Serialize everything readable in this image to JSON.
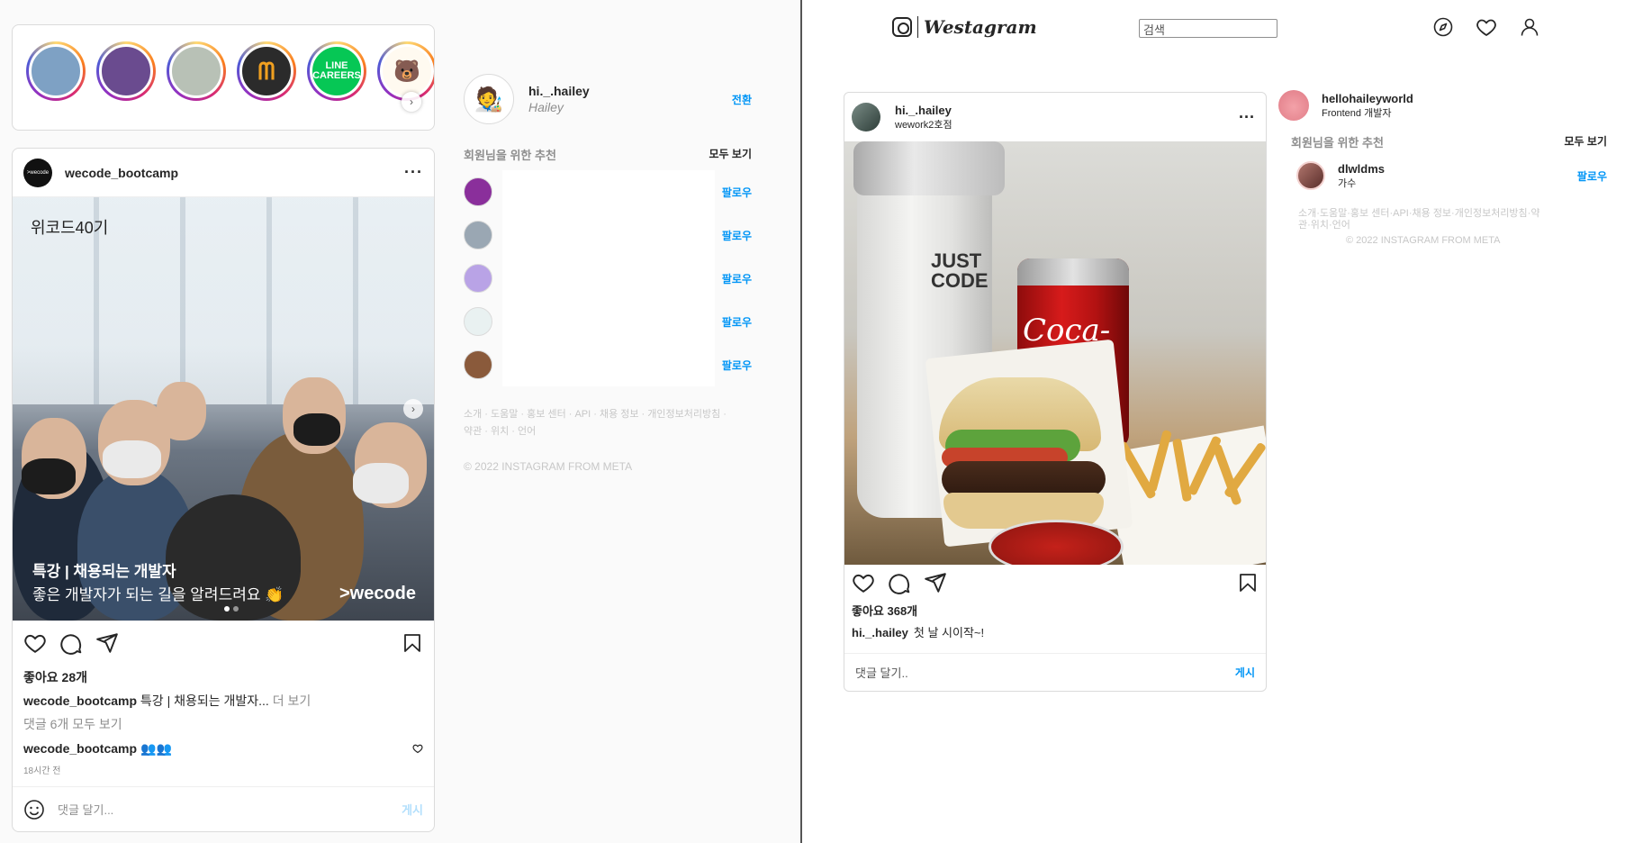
{
  "left": {
    "stories": [
      {
        "name": "story-1",
        "bg": "#7ea1c4",
        "text": ""
      },
      {
        "name": "story-2",
        "bg": "#6a4b8f",
        "text": ""
      },
      {
        "name": "story-3",
        "bg": "#b8c1b6",
        "text": ""
      },
      {
        "name": "story-4",
        "bg": "#2b2b2b",
        "text": "ᗰ"
      },
      {
        "name": "story-5",
        "bg": "#06c755",
        "text": "LINE\nCAREERS"
      },
      {
        "name": "story-6",
        "bg": "#fffaf0",
        "text": "🐻"
      }
    ],
    "post": {
      "username": "wecode_bootcamp",
      "cohort_text": "위코드40기",
      "caption_line1": "특강 | 채용되는 개발자",
      "caption_line2": "좋은 개발자가 되는 길을 알려드려요 👏",
      "brand": ">wecode",
      "likes": "좋아요 28개",
      "caption_user": "wecode_bootcamp",
      "caption_text": "특강 | 채용되는 개발자...",
      "caption_more": "더 보기",
      "view_comments": "댓글 6개 모두 보기",
      "comment_user": "wecode_bootcamp",
      "comment_text": "👥👥",
      "time": "18시간 전",
      "add_comment_placeholder": "댓글 달기...",
      "post_label": "게시"
    },
    "sidebar": {
      "username": "hi._.hailey",
      "name": "Hailey",
      "switch_label": "전환",
      "rec_title": "회원님을 위한 추천",
      "rec_all": "모두 보기",
      "items": [
        {
          "avatar_bg": "#8a2f9b",
          "follow": "팔로우"
        },
        {
          "avatar_bg": "#9aa7b3",
          "follow": "팔로우"
        },
        {
          "avatar_bg": "#b9a3e6",
          "follow": "팔로우"
        },
        {
          "avatar_bg": "#e9f1f1",
          "follow": "팔로우"
        },
        {
          "avatar_bg": "#8a5a3b",
          "follow": "팔로우"
        }
      ],
      "footer_line1": "소개 · 도움말 · 홍보 센터 · API · 채용 정보 · 개인정보처리방침 ·",
      "footer_line2": "약관 · 위치 · 언어",
      "copyright": "© 2022 INSTAGRAM FROM META"
    }
  },
  "right": {
    "logo_text": "Westagram",
    "search_value": "검색",
    "post": {
      "username": "hi._.hailey",
      "location": "wework2호점",
      "tumbler_text": "JUST\nCODE",
      "can_text": "Coca-Cola",
      "likes": "좋아요 368개",
      "caption_user": "hi._.hailey",
      "caption_text": "첫 날 시이작~!",
      "add_comment_placeholder": "댓글 달기..",
      "post_label": "게시"
    },
    "sidebar": {
      "username": "hellohaileyworld",
      "bio": "Frontend 개발자",
      "rec_title": "회원님을 위한 추천",
      "rec_all": "모두 보기",
      "rec_user": "dlwldms",
      "rec_sub": "가수",
      "follow": "팔로우",
      "footer": "소개·도움말·홍보 센터·API·채용 정보·개인정보처리방침·약관·위치·언어",
      "copyright": "© 2022 INSTAGRAM FROM META"
    }
  }
}
